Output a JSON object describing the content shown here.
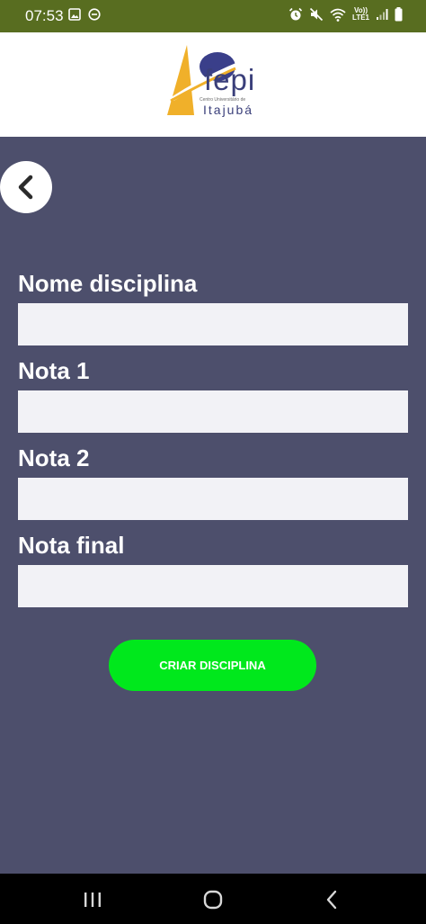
{
  "status_bar": {
    "time": "07:53",
    "lte_top": "Vo))",
    "lte_bottom": "LTE1",
    "left_icons": [
      "image-icon",
      "dnd-icon"
    ],
    "right_icons": [
      "alarm-icon",
      "mute-icon",
      "wifi-icon",
      "lte-icon",
      "signal-icon",
      "battery-icon"
    ]
  },
  "header": {
    "logo_text": "fepi",
    "logo_tagline": "Centro Universitário de",
    "logo_city": "Itajubá"
  },
  "form": {
    "fields": [
      {
        "label": "Nome disciplina",
        "value": "",
        "placeholder": ""
      },
      {
        "label": "Nota 1",
        "value": "",
        "placeholder": ""
      },
      {
        "label": "Nota 2",
        "value": "",
        "placeholder": ""
      },
      {
        "label": "Nota final",
        "value": "",
        "placeholder": ""
      }
    ],
    "submit_label": "CRIAR DISCIPLINA"
  },
  "nav_bar": {
    "buttons": [
      "recents-icon",
      "home-icon",
      "back-icon"
    ]
  },
  "colors": {
    "status_bar": "#586d20",
    "background": "#4d4f6c",
    "button": "#00e81c",
    "input": "#f2f2f6"
  }
}
